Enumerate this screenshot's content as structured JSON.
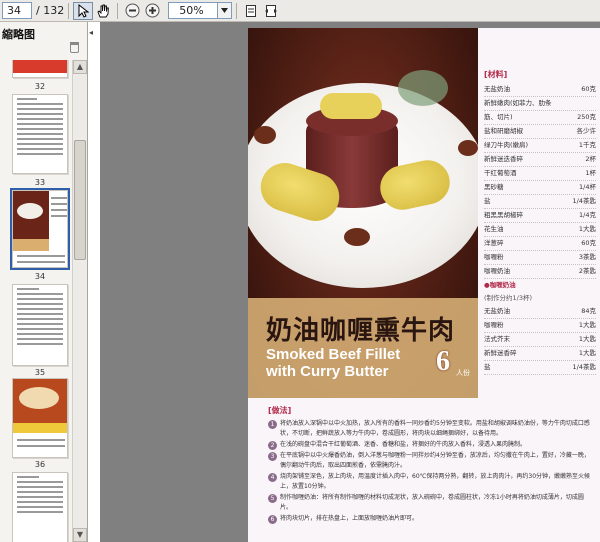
{
  "toolbar": {
    "page_current": "34",
    "page_total": "/ 132",
    "zoom_value": "50%"
  },
  "panel": {
    "title": "縮略图",
    "thumbnail_labels": [
      "32",
      "33",
      "34",
      "35",
      "36"
    ]
  },
  "recipe": {
    "title_cn": "奶油咖喱熏牛肉",
    "title_en_line1": "Smoked Beef Fillet",
    "title_en_line2": "with Curry Butter",
    "serves_number": "6",
    "serves_unit": "人份",
    "ingredients_heading": "[材料]",
    "ingredients": [
      {
        "name": "无盐奶油",
        "amount": "60克"
      },
      {
        "name": "新鲜嫩肉(如菲力、肋条",
        "amount": ""
      },
      {
        "name": "筋、切片)",
        "amount": "250克"
      },
      {
        "name": "盐和研磨胡椒",
        "amount": "各少许"
      },
      {
        "name": "绿刀牛肉(嫩肩)",
        "amount": "1千克"
      },
      {
        "name": "新鲜迷迭香碎",
        "amount": "2杯"
      },
      {
        "name": "干红葡萄酒",
        "amount": "1杯"
      },
      {
        "name": "黑砂糖",
        "amount": "1/4杯"
      },
      {
        "name": "盐",
        "amount": "1/4茶匙"
      },
      {
        "name": "粗黑黑胡椒碎",
        "amount": "1/4克"
      },
      {
        "name": "花生油",
        "amount": "1大匙"
      },
      {
        "name": "洋葱碎",
        "amount": "60克"
      },
      {
        "name": "咖喱粉",
        "amount": "3茶匙"
      },
      {
        "name": "咖喱奶油",
        "amount": "2茶匙"
      }
    ],
    "sub_heading": "●咖喱奶油",
    "sub_note": "(制作分约1/3杯)",
    "sub_ingredients": [
      {
        "name": "无盐奶油",
        "amount": "84克"
      },
      {
        "name": "咖喱粉",
        "amount": "1大匙"
      },
      {
        "name": "法式芥末",
        "amount": "1大匙"
      },
      {
        "name": "新鲜迷香碎",
        "amount": "1大匙"
      },
      {
        "name": "盐",
        "amount": "1/4茶匙"
      }
    ],
    "method_heading": "[做法]",
    "steps": [
      "将奶油放入深锅中以中火加热，放入所有的香料一同炒香约5分钟至变软。用盐和胡椒调味奶油份，等力牛肉切成口感状，不切断，把鲜蔬放入等力牛肉中，卷成圆形，将肉块以细绳捆绑好，以备待用。",
      "在浅的碗盘中混合干红葡萄酒、迷香、香糖和盐，将捆好的牛肉放入香料，浸透入果肉腌制。",
      "在平底锅中以中火爆香奶油，倒入洋葱与咖喱粉一同拌炒约4分钟至香，放凉后，均匀撒在牛肉上，置好，冷藏一晚，偶尔翻动牛肉后，取出四面煎香，依需腌肉汁。",
      "烧肉架铺至深色，放上肉块，用温度计插入肉中，60℃保持两分熟，翻转，放上肉肉汁，再约30分钟，嫩嫩熟至火候上，放置10分钟。",
      "制作咖喱奶油：将所有制作咖喱的材料切成泥状，放入碗碗中，卷成圆柱状，冷冻1小时再将奶油切成薄片，切成圆片。",
      "将肉块切片，排在热盘上，上面放咖喱奶油片即可。"
    ]
  },
  "colors": {
    "accent": "#b02a4a",
    "doc_background": "#808080",
    "title_band": "#dab278"
  }
}
